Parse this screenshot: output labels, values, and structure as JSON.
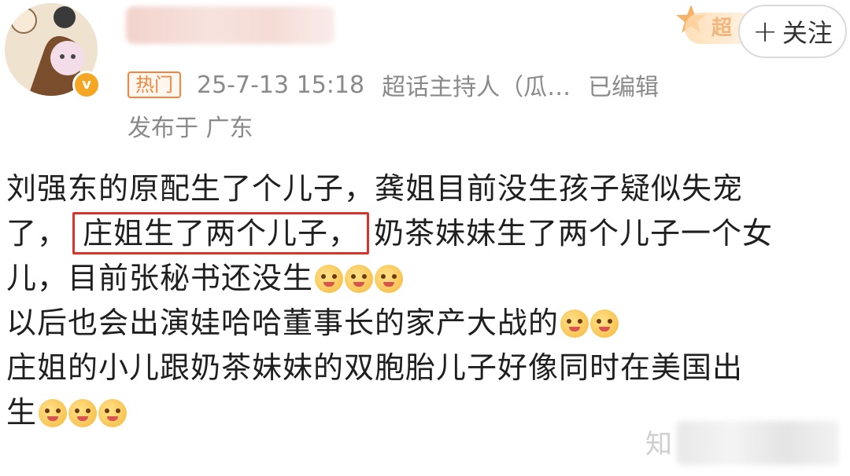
{
  "post": {
    "hot_label": "热门",
    "timestamp": "25-7-13 15:18",
    "source": "超话主持人（瓜…",
    "edited": "已编辑",
    "location": "发布于 广东",
    "follow_label": "关注",
    "follow_icon": "plus-icon",
    "super_badge_text": "超"
  },
  "content": {
    "line1": "刘强东的原配生了个儿子，龚姐目前没生孩子疑似失宠",
    "line2_pre": "了，",
    "line2_highlight": "庄姐生了两个儿子，",
    "line2_post": "奶茶妹妹生了两个儿子一个女",
    "line3": "儿，目前张秘书还没生",
    "line4": "以后也会出演娃哈哈董事长的家产大战的",
    "line5": "庄姐的小儿跟奶茶妹妹的双胞胎儿子好像同时在美国出",
    "line6": "生"
  },
  "watermark": {
    "text": "知"
  },
  "colors": {
    "highlight_border": "#d9342b",
    "hot_tag": "#f5853c",
    "vip_badge": "#f5a623"
  }
}
